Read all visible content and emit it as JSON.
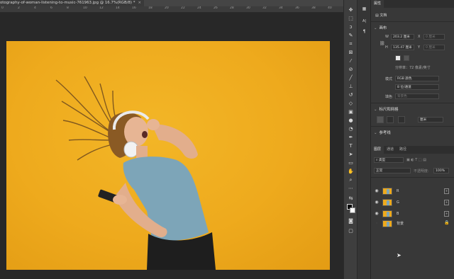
{
  "document_tab": {
    "title": "otography-of-woman-listening-to-music-761963.jpg @ 16.7%(RGB/8) *",
    "close_label": "×"
  },
  "ruler": {
    "labels": [
      "0",
      "2",
      "4",
      "6",
      "8",
      "10",
      "12",
      "14",
      "16",
      "18",
      "20",
      "22",
      "24",
      "26",
      "28",
      "30",
      "32",
      "34",
      "36",
      "38",
      "40"
    ]
  },
  "tools": {
    "icons": [
      "move-icon",
      "marquee-icon",
      "lasso-icon",
      "quick-select-icon",
      "crop-icon",
      "frame-icon",
      "eyedropper-icon",
      "healing-brush-icon",
      "brush-icon",
      "clone-stamp-icon",
      "history-brush-icon",
      "eraser-icon",
      "gradient-icon",
      "blur-icon",
      "dodge-icon",
      "pen-icon",
      "type-icon",
      "path-select-icon",
      "rectangle-icon",
      "hand-icon",
      "zoom-icon",
      "more-tools-icon",
      "swap-colors-icon",
      "foreground-color-icon",
      "quick-mask-icon",
      "screen-mode-icon"
    ]
  },
  "icon_strip": {
    "icons": [
      "history-panel-icon",
      "character-panel-icon",
      "paragraph-panel-icon"
    ],
    "labels": [
      "",
      "A|",
      "¶"
    ]
  },
  "properties": {
    "tab_label": "属性",
    "doc_label": "文档",
    "canvas_section": "画布",
    "w_label": "W",
    "w_value": "203.2 厘米",
    "x_label": "X",
    "x_value": "0 厘米",
    "h_label": "H",
    "h_value": "135.47 厘米",
    "y_label": "Y",
    "y_value": "0 厘米",
    "resolution": "分辨率：72 像素/英寸",
    "mode_label": "模式",
    "mode_value": "RGB 颜色",
    "depth_value": "8 位/通道",
    "fill_label": "填色",
    "fill_value": "背景色",
    "rulers_section": "标尺和网格",
    "unit_value": "厘米",
    "guides_section": "参考线"
  },
  "layers": {
    "tabs": [
      "图层",
      "通道",
      "路径"
    ],
    "filter_label": "类型",
    "blend_mode": "正常",
    "opacity_label": "不透明度:",
    "opacity_value": "100%",
    "items": [
      {
        "name": "R",
        "visible": true
      },
      {
        "name": "G",
        "visible": true
      },
      {
        "name": "B",
        "visible": true
      },
      {
        "name": "背景",
        "visible": false
      }
    ]
  },
  "colors": {
    "background_yellow": "#eeaa1d",
    "panel_gray": "#383838",
    "canvas_gray": "#282828",
    "shirt_blue": "#7da5b8"
  }
}
